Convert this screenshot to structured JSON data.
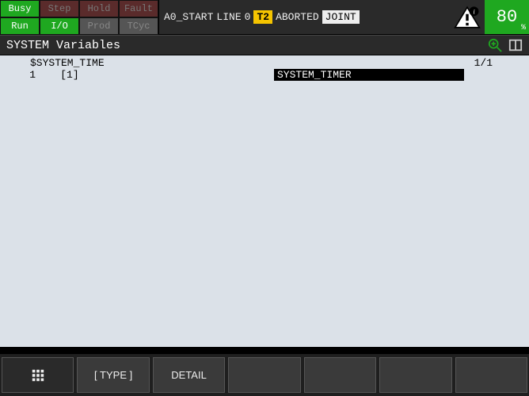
{
  "status": {
    "busy": "Busy",
    "step": "Step",
    "hold": "Hold",
    "fault": "Fault",
    "run": "Run",
    "io": "I/O",
    "prod": "Prod",
    "tcyc": "TCyc"
  },
  "program": {
    "name": "A0_START",
    "line_label": "LINE",
    "line": "0",
    "mode": "T2",
    "state": "ABORTED",
    "coord": "JOINT"
  },
  "speed": {
    "value": "80",
    "unit": "%"
  },
  "title": "SYSTEM Variables",
  "content": {
    "var_name": "$SYSTEM_TIME",
    "page": "1/1",
    "rows": [
      {
        "index": "1",
        "bracket": "[1]",
        "value": "SYSTEM_TIMER"
      }
    ]
  },
  "fkeys": {
    "f1": "",
    "f2": "[ TYPE ]",
    "f3": "DETAIL",
    "f4": "",
    "f5": "",
    "f6": "",
    "f7": ""
  }
}
